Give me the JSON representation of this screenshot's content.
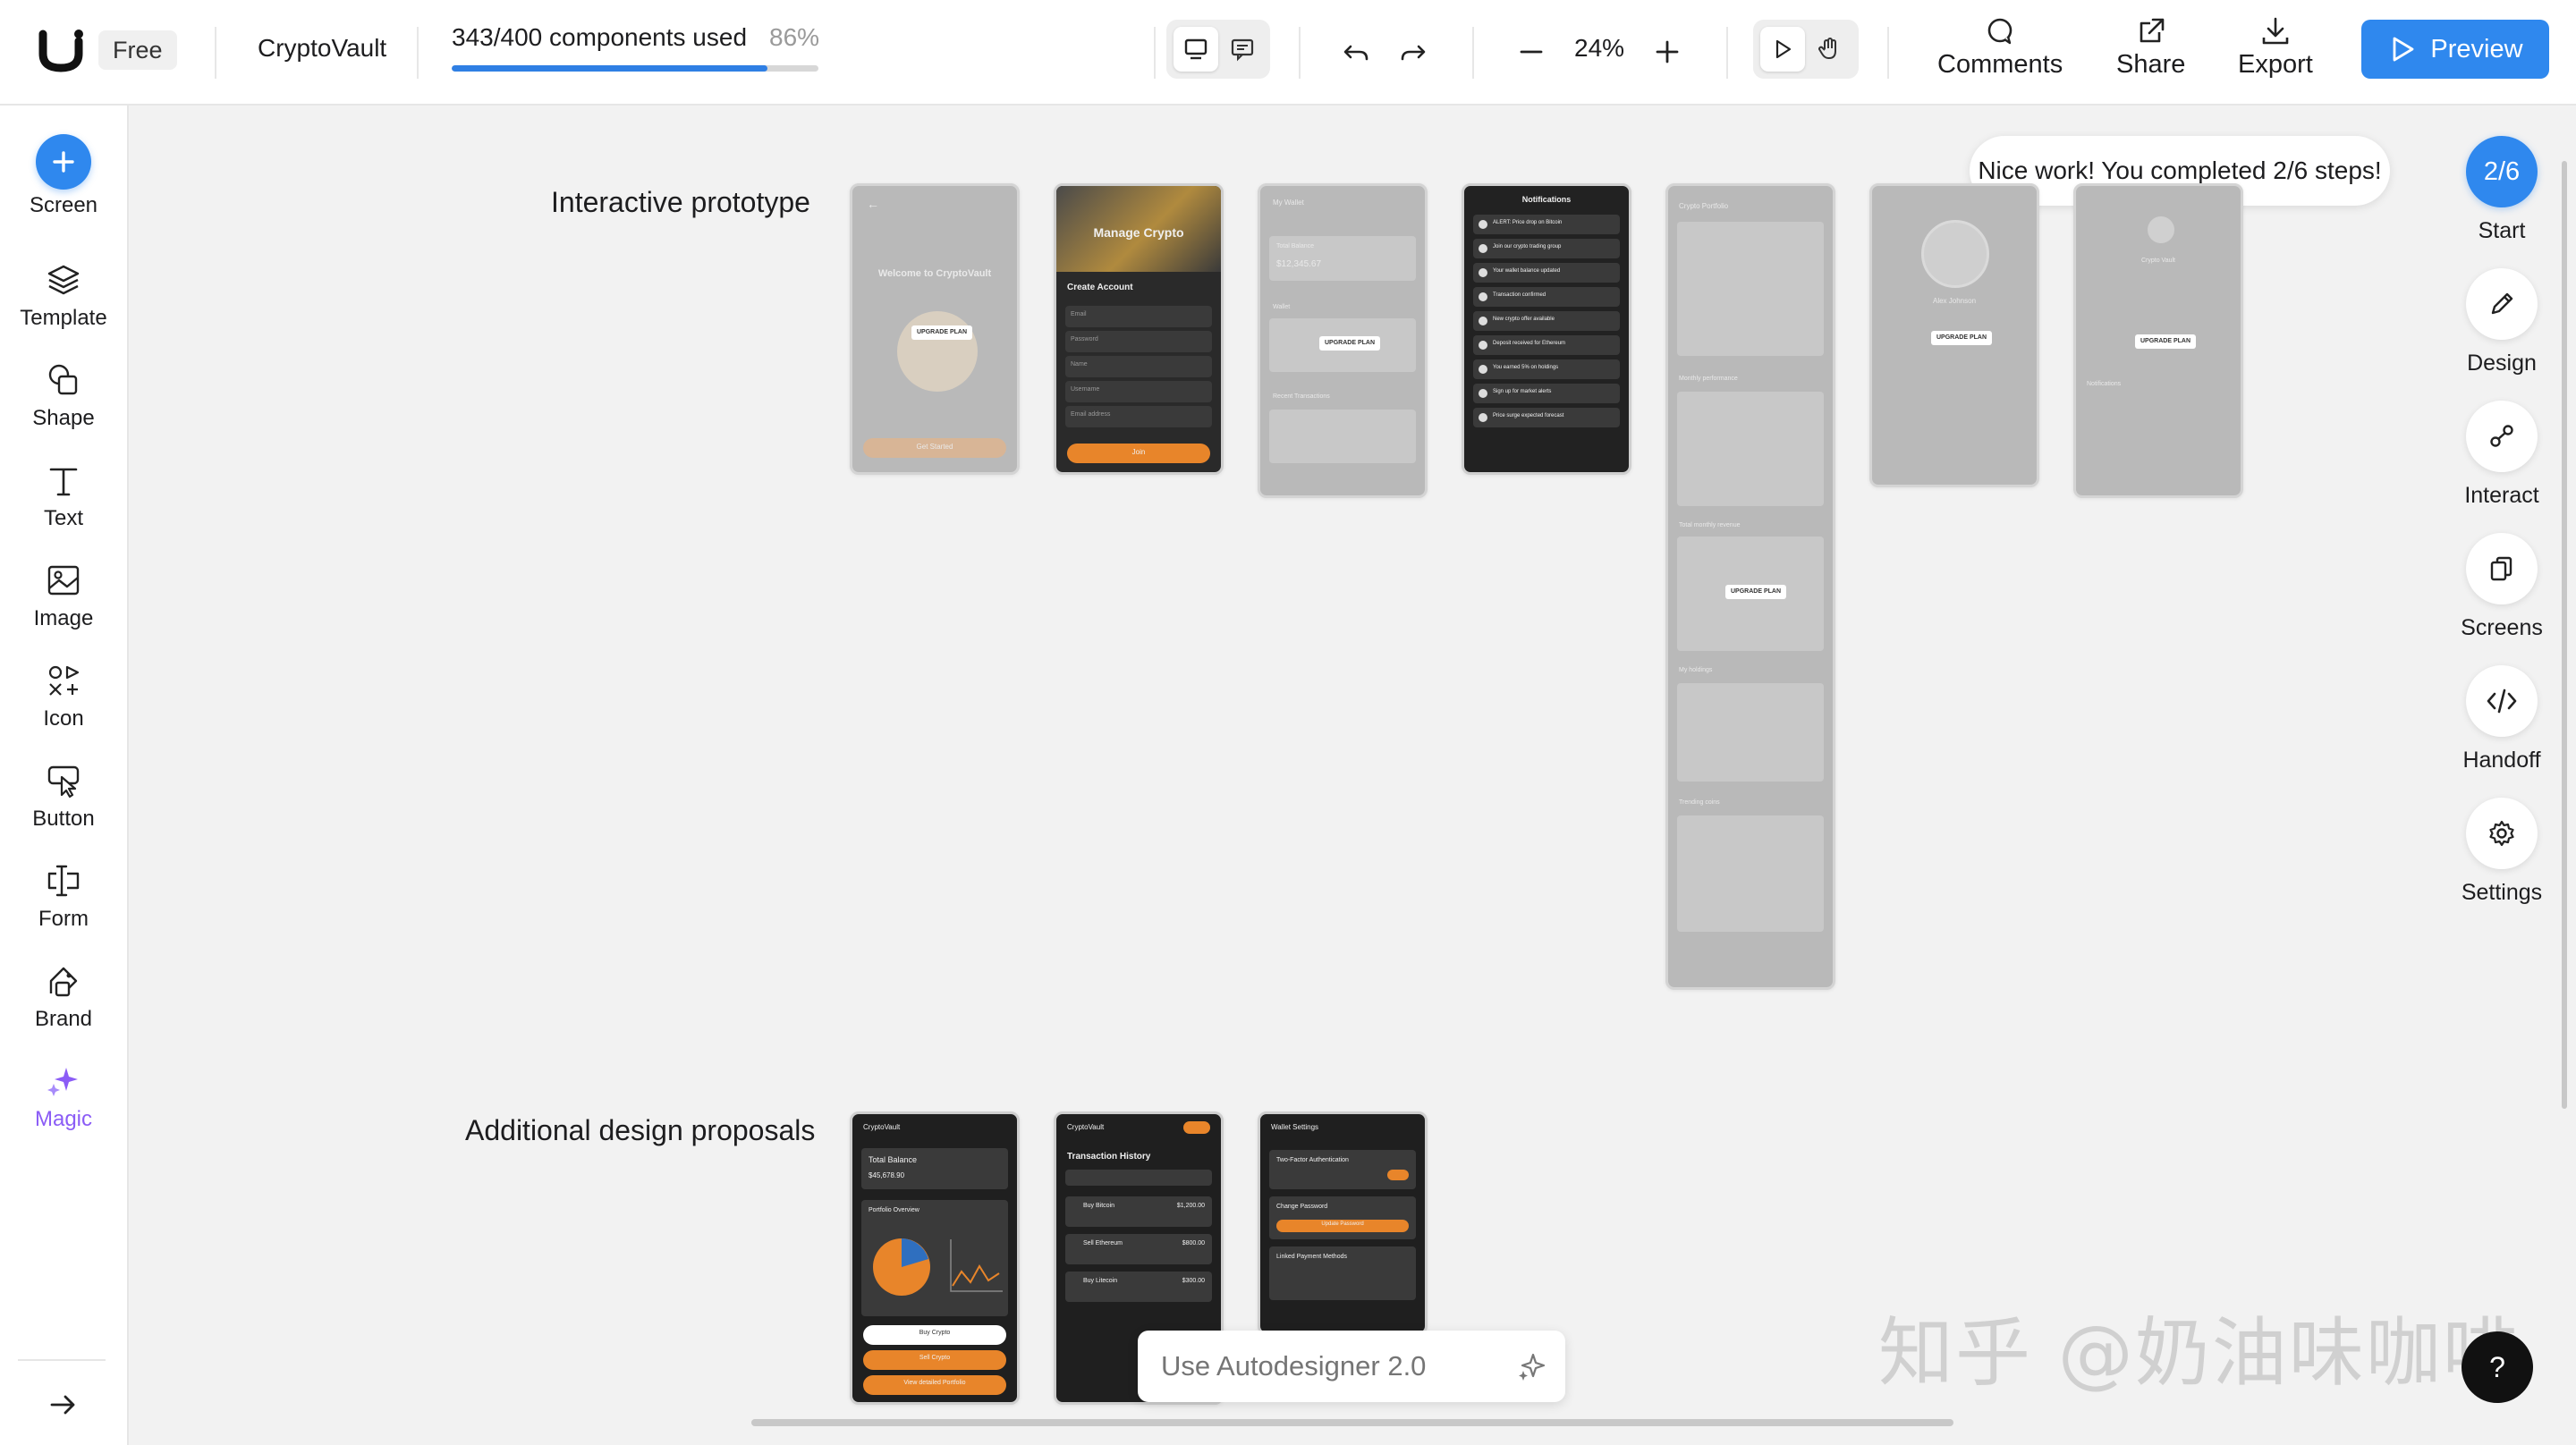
{
  "header": {
    "plan": "Free",
    "project_name": "CryptoVault",
    "usage_text": "343/400 components used",
    "usage_percent": "86%",
    "usage_fraction": 0.86,
    "zoom": "24%",
    "actions": {
      "comments": "Comments",
      "share": "Share",
      "export": "Export",
      "preview": "Preview"
    }
  },
  "sidebar": {
    "tools": [
      {
        "label": "Screen",
        "icon": "plus-icon"
      },
      {
        "label": "Template",
        "icon": "layers-icon"
      },
      {
        "label": "Shape",
        "icon": "shapes-icon"
      },
      {
        "label": "Text",
        "icon": "text-icon"
      },
      {
        "label": "Image",
        "icon": "image-icon"
      },
      {
        "label": "Icon",
        "icon": "icons-icon"
      },
      {
        "label": "Button",
        "icon": "cursor-button-icon"
      },
      {
        "label": "Form",
        "icon": "form-cursor-icon"
      },
      {
        "label": "Brand",
        "icon": "brand-icon"
      },
      {
        "label": "Magic",
        "icon": "sparkle-icon"
      }
    ]
  },
  "right_panel": {
    "step": "2/6",
    "start_label": "Start",
    "toast": "Nice work! You completed 2/6 steps!",
    "tools": [
      {
        "label": "Design",
        "icon": "pencil-icon"
      },
      {
        "label": "Interact",
        "icon": "interact-icon"
      },
      {
        "label": "Screens",
        "icon": "screens-icon"
      },
      {
        "label": "Handoff",
        "icon": "code-icon"
      },
      {
        "label": "Settings",
        "icon": "gear-icon"
      }
    ]
  },
  "canvas": {
    "section1_label": "Interactive prototype",
    "section2_label": "Additional design proposals",
    "screens1": [
      {
        "name": "welcome",
        "title": "Welcome to CryptoVault",
        "upgrade": "UPGRADE PLAN",
        "cta": "Get Started"
      },
      {
        "name": "create-account",
        "hero": "Manage Crypto",
        "title": "Create Account",
        "fields": [
          "Email",
          "Password",
          "Name",
          "Username",
          "Email address"
        ],
        "cta": "Join"
      },
      {
        "name": "my-wallet",
        "title": "My Wallet",
        "balance_label": "Total Balance",
        "balance": "$12,345.67",
        "wallet_label": "Wallet",
        "recent": "Recent Transactions",
        "upgrade": "UPGRADE PLAN"
      },
      {
        "name": "notifications",
        "title": "Notifications",
        "items": [
          "ALERT: Price drop on Bitcoin",
          "Join our crypto trading group",
          "Your wallet balance updated",
          "Transaction confirmed",
          "New crypto offer available",
          "Deposit received for Ethereum",
          "You earned 5% on holdings",
          "Sign up for market alerts",
          "Price surge expected forecast"
        ]
      },
      {
        "name": "crypto-portfolio",
        "title": "Crypto Portfolio",
        "monthly": "Monthly performance",
        "revenue": "Total monthly revenue",
        "holdings": "My holdings",
        "trending": "Trending coins",
        "upgrade": "UPGRADE PLAN"
      },
      {
        "name": "profile",
        "user": "Alex Johnson",
        "upgrade": "UPGRADE PLAN"
      },
      {
        "name": "settings",
        "title": "Crypto Vault",
        "notifications": "Notifications",
        "upgrade": "UPGRADE PLAN"
      }
    ],
    "screens2": [
      {
        "name": "proposal-dashboard",
        "app": "CryptoVault",
        "balance_label": "Total Balance",
        "balance": "$45,678.90",
        "overview": "Portfolio Overview",
        "buttons": [
          "Buy Crypto",
          "Sell Crypto",
          "View detailed Portfolio"
        ]
      },
      {
        "name": "proposal-history",
        "app": "CryptoVault",
        "title": "Transaction History",
        "rows": [
          "Buy Bitcoin",
          "Sell Ethereum",
          "Buy Litecoin"
        ],
        "amounts": [
          "$1,200.00",
          "$800.00",
          "$300.00"
        ]
      },
      {
        "name": "proposal-wallet-settings",
        "title": "Wallet Settings",
        "two_factor": "Two-Factor Authentication",
        "change_password": "Change Password",
        "update_password": "Update Password",
        "linked": "Linked Payment Methods"
      }
    ]
  },
  "autodesigner": {
    "placeholder": "Use Autodesigner 2.0"
  },
  "help": "?",
  "watermark": "知乎 @奶油味咖啡"
}
